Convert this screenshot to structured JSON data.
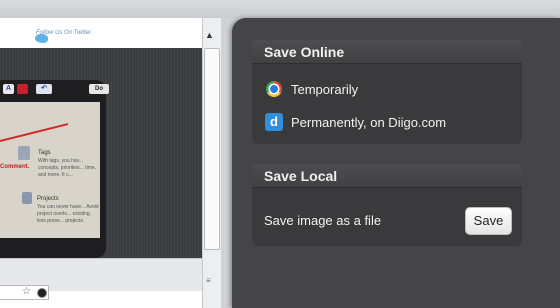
{
  "page": {
    "follow_link": "Follow Us On Twitter",
    "tablet": {
      "a_button": "A",
      "undo_button": "↶",
      "do_button": "Do",
      "comment_label": "Comment.",
      "tags_title": "Tags",
      "tags_text": "With tags, you hav... concepts, priorities... time, and more. It c...",
      "projects_title": "Projects",
      "projects_text": "You can never have... Avoid project overlo... existing, less prese... projects."
    }
  },
  "popup": {
    "online": {
      "title": "Save Online",
      "temporarily": "Temporarily",
      "permanently": "Permanently, on Diigo.com",
      "diigo_letter": "d"
    },
    "local": {
      "title": "Save Local",
      "label": "Save image as a file",
      "button": "Save"
    }
  }
}
